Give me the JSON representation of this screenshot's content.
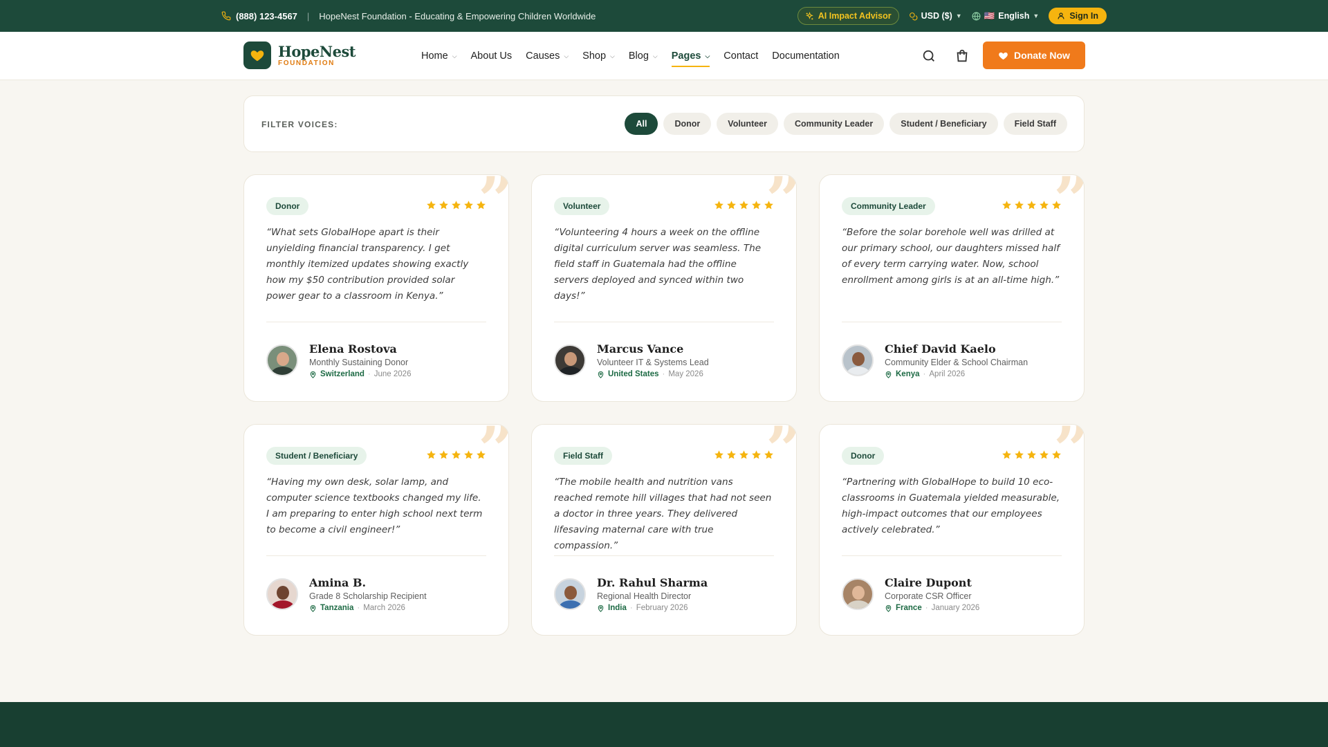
{
  "topbar": {
    "phone": "(888) 123-4567",
    "tagline": "HopeNest Foundation - Educating & Empowering Children Worldwide",
    "ai_advisor": "AI Impact Advisor",
    "currency": "USD ($)",
    "language": "English",
    "language_flag": "🇺🇸",
    "signin": "Sign In"
  },
  "header": {
    "logo_name": "HopeNest",
    "logo_sub": "FOUNDATION",
    "nav": [
      {
        "label": "Home",
        "dropdown": true
      },
      {
        "label": "About Us",
        "dropdown": false
      },
      {
        "label": "Causes",
        "dropdown": true
      },
      {
        "label": "Shop",
        "dropdown": true
      },
      {
        "label": "Blog",
        "dropdown": true
      },
      {
        "label": "Pages",
        "dropdown": true,
        "active": true
      },
      {
        "label": "Contact",
        "dropdown": false
      },
      {
        "label": "Documentation",
        "dropdown": false
      }
    ],
    "donate": "Donate Now"
  },
  "filter": {
    "label": "FILTER VOICES:",
    "chips": [
      "All",
      "Donor",
      "Volunteer",
      "Community Leader",
      "Student / Beneficiary",
      "Field Staff"
    ],
    "selected": "All"
  },
  "testimonials": [
    {
      "tag": "Donor",
      "rating": 5,
      "quote": "“What sets GlobalHope apart is their unyielding financial transparency. I get monthly itemized updates showing exactly how my $50 contribution provided solar power gear to a classroom in Kenya.”",
      "name": "Elena Rostova",
      "role": "Monthly Sustaining Donor",
      "location": "Switzerland",
      "date": "June 2026"
    },
    {
      "tag": "Volunteer",
      "rating": 5,
      "quote": "“Volunteering 4 hours a week on the offline digital curriculum server was seamless. The field staff in Guatemala had the offline servers deployed and synced within two days!”",
      "name": "Marcus Vance",
      "role": "Volunteer IT & Systems Lead",
      "location": "United States",
      "date": "May 2026"
    },
    {
      "tag": "Community Leader",
      "rating": 5,
      "quote": "“Before the solar borehole well was drilled at our primary school, our daughters missed half of every term carrying water. Now, school enrollment among girls is at an all-time high.”",
      "name": "Chief David Kaelo",
      "role": "Community Elder & School Chairman",
      "location": "Kenya",
      "date": "April 2026"
    },
    {
      "tag": "Student / Beneficiary",
      "rating": 5,
      "quote": "“Having my own desk, solar lamp, and computer science textbooks changed my life. I am preparing to enter high school next term to become a civil engineer!”",
      "name": "Amina B.",
      "role": "Grade 8 Scholarship Recipient",
      "location": "Tanzania",
      "date": "March 2026"
    },
    {
      "tag": "Field Staff",
      "rating": 5,
      "quote": "“The mobile health and nutrition vans reached remote hill villages that had not seen a doctor in three years. They delivered lifesaving maternal care with true compassion.”",
      "name": "Dr. Rahul Sharma",
      "role": "Regional Health Director",
      "location": "India",
      "date": "February 2026"
    },
    {
      "tag": "Donor",
      "rating": 5,
      "quote": "“Partnering with GlobalHope to build 10 eco-classrooms in Guatemala yielded measurable, high-impact outcomes that our employees actively celebrated.”",
      "name": "Claire Dupont",
      "role": "Corporate CSR Officer",
      "location": "France",
      "date": "January 2026"
    }
  ],
  "colors": {
    "brand_green": "#1d4a3a",
    "accent_orange": "#f07a1b",
    "star_gold": "#f5b40f"
  }
}
